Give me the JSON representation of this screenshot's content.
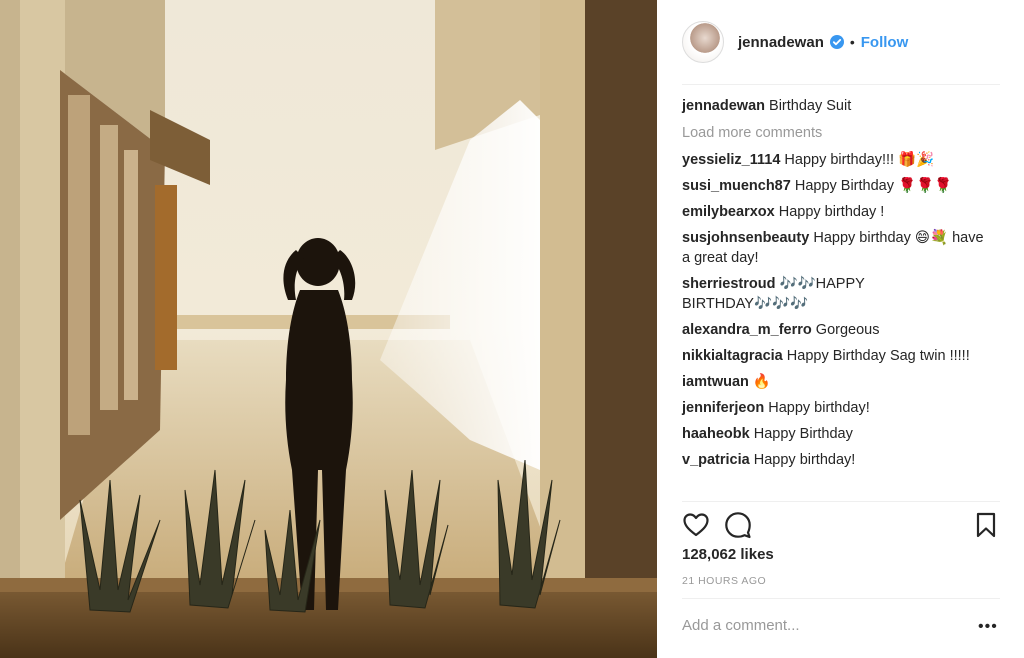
{
  "post": {
    "username": "jennadewan",
    "follow_label": "Follow",
    "separator": "•",
    "caption": {
      "user": "jennadewan",
      "text": "Birthday Suit"
    },
    "load_more_label": "Load more comments",
    "comments": [
      {
        "user": "yessieliz_1114",
        "text": "Happy birthday!!! 🎁🎉"
      },
      {
        "user": "susi_muench87",
        "text": "Happy Birthday 🌹🌹🌹"
      },
      {
        "user": "emilybearxox",
        "text": "Happy birthday !"
      },
      {
        "user": "susjohnsenbeauty",
        "text": "Happy birthday 😄💐 have a great day!"
      },
      {
        "user": "sherriestroud",
        "text": "🎶🎶HAPPY BIRTHDAY🎶🎶🎶"
      },
      {
        "user": "alexandra_m_ferro",
        "text": "Gorgeous"
      },
      {
        "user": "nikkialtagracia",
        "text": "Happy Birthday Sag twin !!!!!"
      },
      {
        "user": "iamtwuan",
        "text": "🔥"
      },
      {
        "user": "jenniferjeon",
        "text": "Happy birthday!"
      },
      {
        "user": "haaheobk",
        "text": "Happy Birthday"
      },
      {
        "user": "v_patricia",
        "text": "Happy birthday!"
      }
    ],
    "likes": "128,062 likes",
    "time_ago": "21 HOURS AGO",
    "add_comment_placeholder": "Add a comment...",
    "more_label": "•••"
  },
  "icons": {
    "verified": "verified-badge-icon",
    "like": "heart-icon",
    "comment": "comment-bubble-icon",
    "save": "bookmark-icon"
  },
  "colors": {
    "link_blue": "#3897f0",
    "text": "#262626",
    "muted": "#999999",
    "divider": "#efefef"
  }
}
